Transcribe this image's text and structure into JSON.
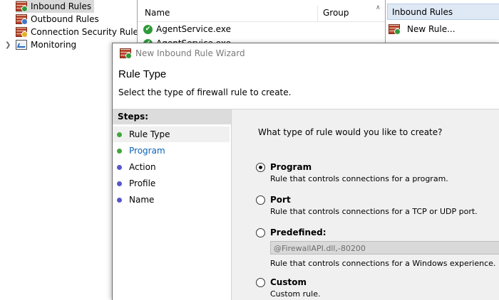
{
  "tree": {
    "items": [
      {
        "label": "Inbound Rules",
        "selected": true
      },
      {
        "label": "Outbound Rules",
        "selected": false
      },
      {
        "label": "Connection Security Rules",
        "selected": false
      },
      {
        "label": "Monitoring",
        "selected": false
      }
    ]
  },
  "list": {
    "columns": [
      "Name",
      "Group"
    ],
    "rows": [
      "AgentService.exe",
      "AgentService.exe"
    ]
  },
  "actions": {
    "header": "Inbound Rules",
    "items": [
      "New Rule..."
    ]
  },
  "wizard": {
    "title": "New Inbound Rule Wizard",
    "page_title": "Rule Type",
    "page_subtitle": "Select the type of firewall rule to create.",
    "steps_label": "Steps:",
    "steps": [
      {
        "label": "Rule Type",
        "state": "current"
      },
      {
        "label": "Program",
        "state": "link"
      },
      {
        "label": "Action",
        "state": "pending"
      },
      {
        "label": "Profile",
        "state": "pending"
      },
      {
        "label": "Name",
        "state": "pending"
      }
    ],
    "question": "What type of rule would you like to create?",
    "options": [
      {
        "title": "Program",
        "description": "Rule that controls connections for a program.",
        "checked": true
      },
      {
        "title": "Port",
        "description": "Rule that controls connections for a TCP or UDP port.",
        "checked": false
      },
      {
        "title": "Predefined:",
        "dropdown_value": "@FirewallAPI.dll,-80200",
        "description": "Rule that controls connections for a Windows experience.",
        "checked": false
      },
      {
        "title": "Custom",
        "description": "Custom rule.",
        "checked": false
      }
    ]
  },
  "colors": {
    "steps_header_bg": "#dcdcdc",
    "content_bg": "#f0f0f0",
    "link_blue": "#0a62b8",
    "actions_header_bg": "#dfe9f5"
  }
}
